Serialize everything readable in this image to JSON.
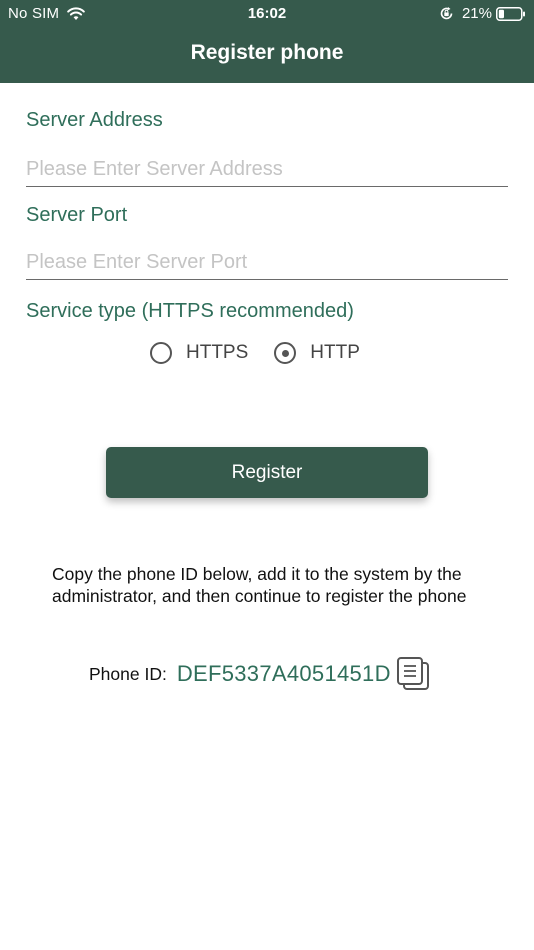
{
  "status_bar": {
    "carrier": "No SIM",
    "time": "16:02",
    "battery_percent": "21%"
  },
  "header": {
    "title": "Register phone"
  },
  "form": {
    "server_address": {
      "label": "Server Address",
      "value": "",
      "placeholder": "Please Enter Server Address"
    },
    "server_port": {
      "label": "Server Port",
      "value": "",
      "placeholder": "Please Enter Server Port"
    },
    "service_type": {
      "label": "Service type (HTTPS recommended)",
      "options": [
        "HTTPS",
        "HTTP"
      ],
      "selected": "HTTP"
    }
  },
  "register_button": {
    "label": "Register"
  },
  "instructions": {
    "text": "Copy the phone ID below, add it to the system by the administrator, and then continue to register the phone"
  },
  "phone_id": {
    "label": "Phone ID:",
    "value": "DEF5337A4051451D"
  },
  "icons": {
    "wifi": "wifi-icon",
    "orientation_lock": "orientation-lock-icon",
    "battery": "battery-icon",
    "copy": "copy-icon"
  },
  "colors": {
    "header_bg": "#365a4c",
    "accent_text": "#2f6e5a",
    "button_bg": "#365a4c"
  }
}
